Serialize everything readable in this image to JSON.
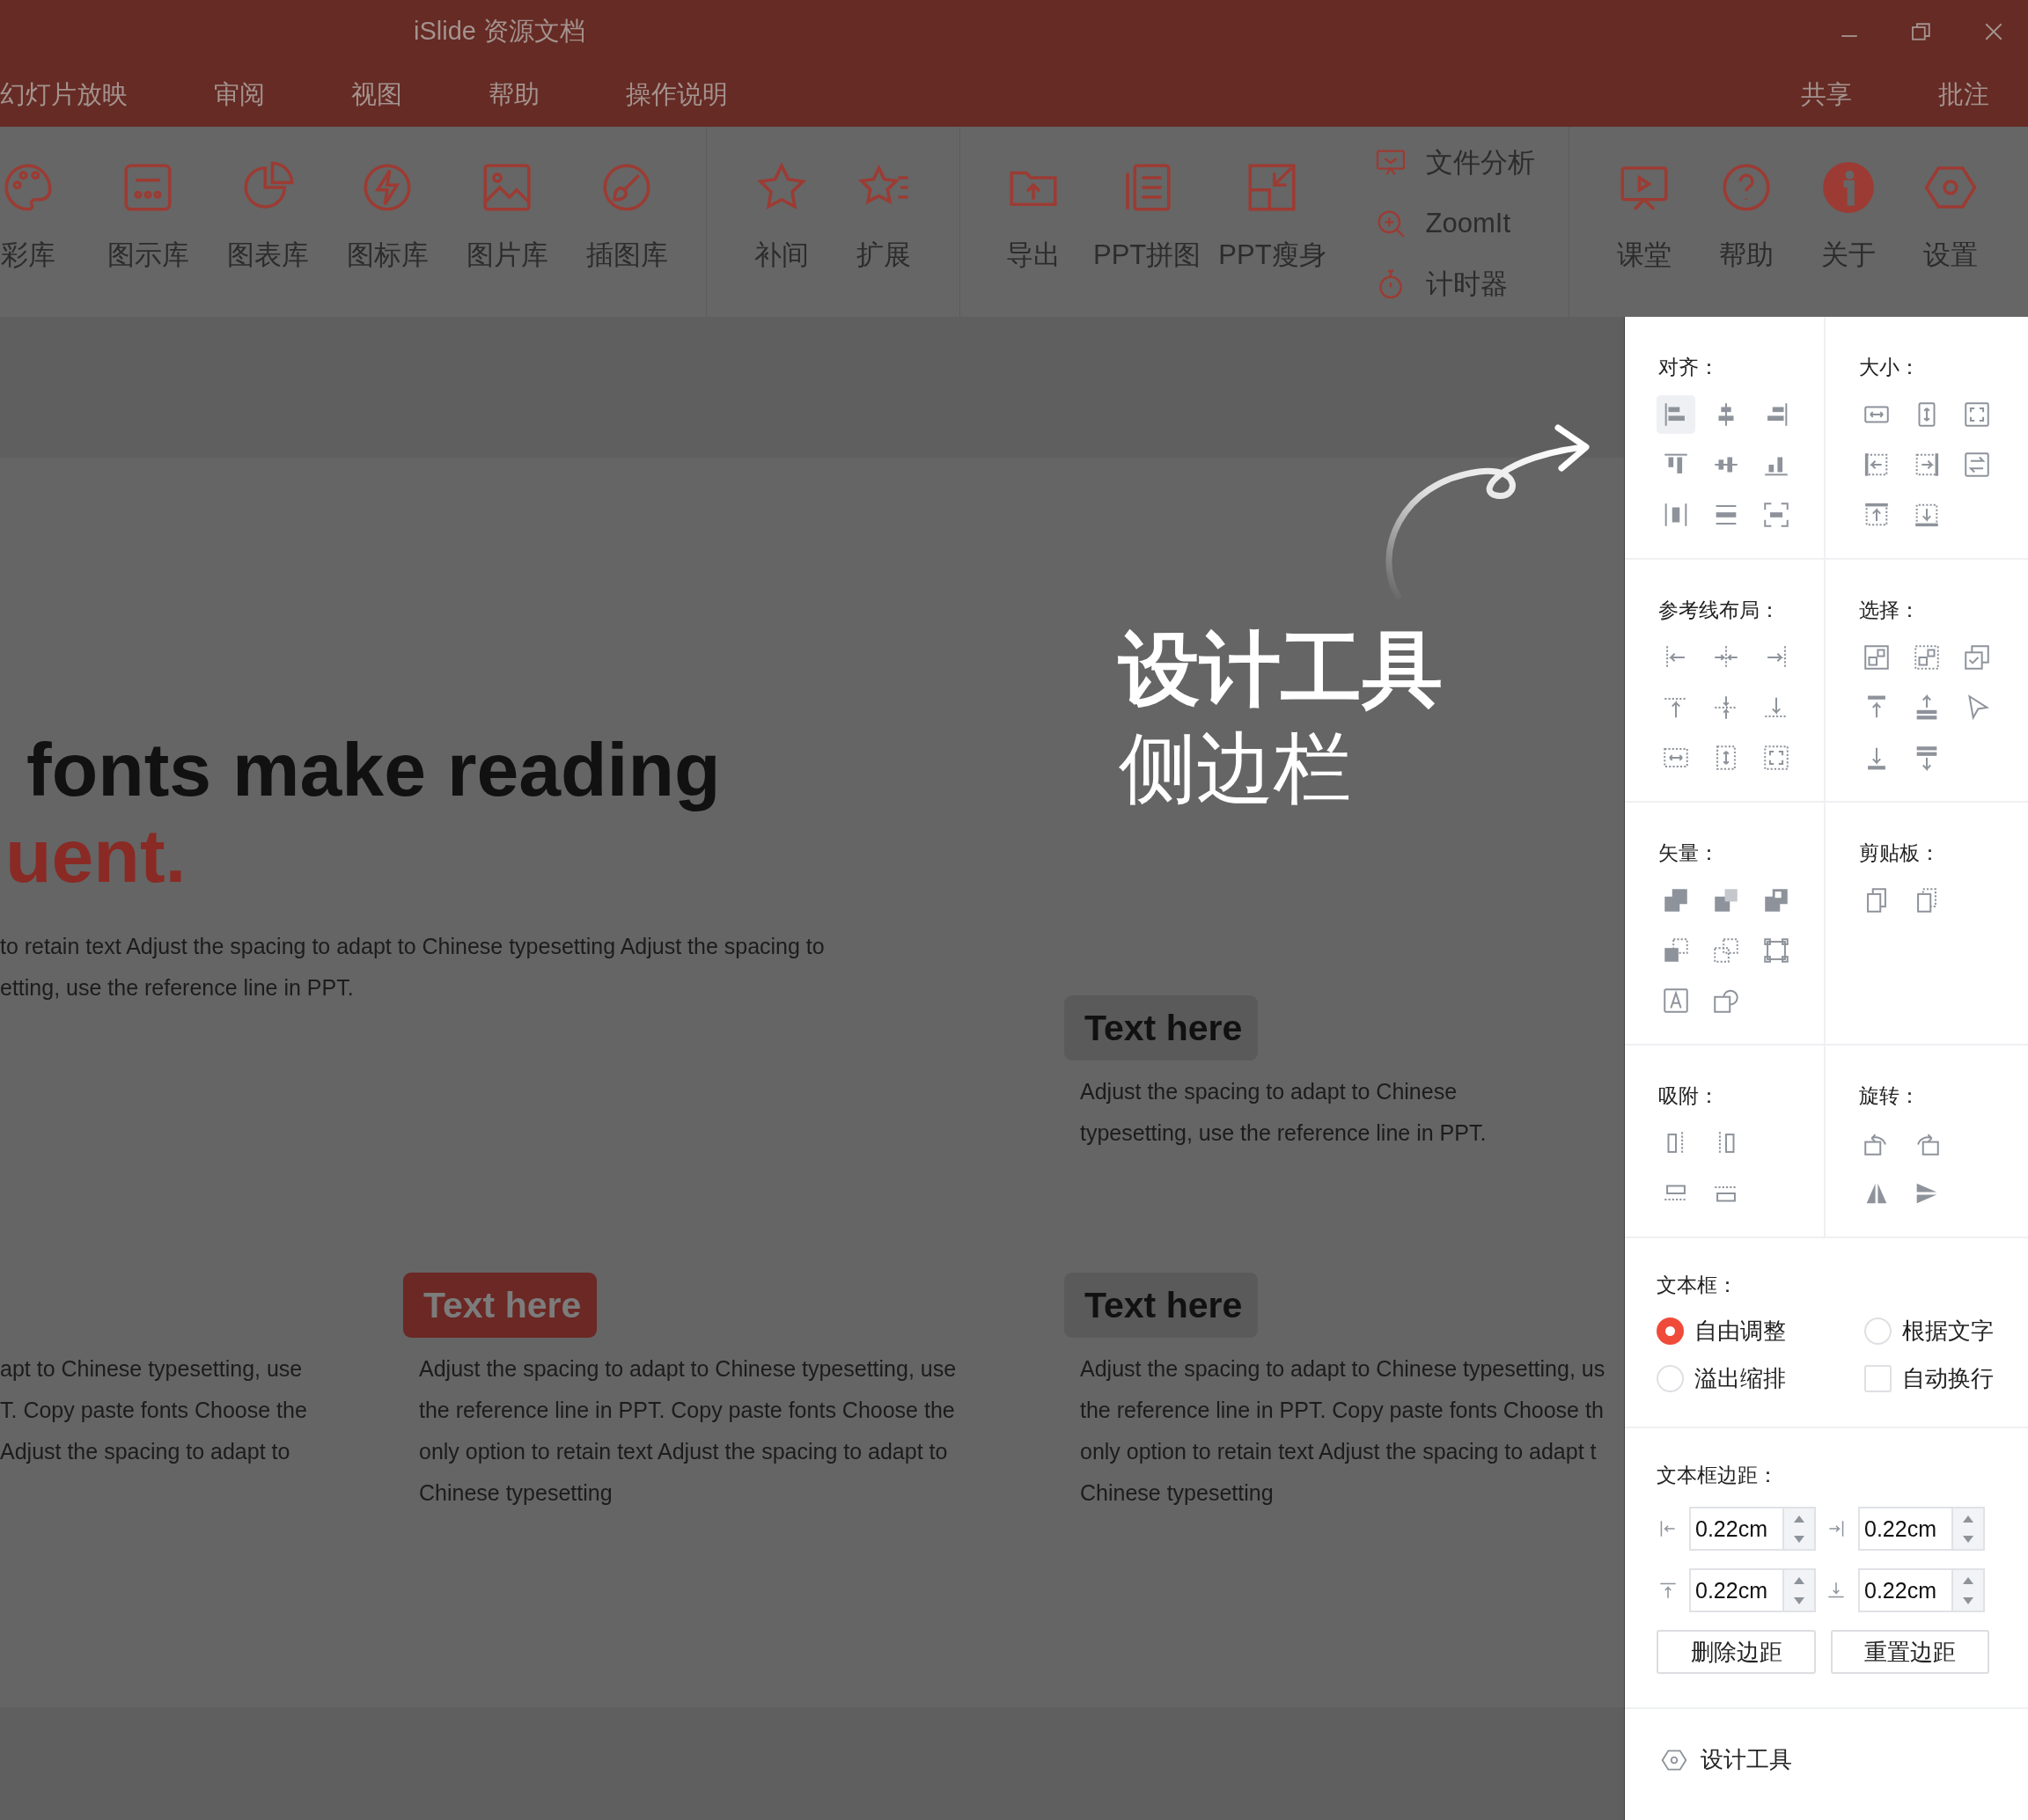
{
  "window": {
    "title": "iSlide 资源文档"
  },
  "menu": {
    "left": [
      {
        "label": "幻灯片放映"
      },
      {
        "label": "审阅"
      },
      {
        "label": "视图"
      },
      {
        "label": "帮助"
      },
      {
        "label": "操作说明"
      }
    ],
    "right": [
      {
        "label": "共享"
      },
      {
        "label": "批注"
      }
    ]
  },
  "toolbar": {
    "groups": [
      {
        "items": [
          {
            "label": "彩库"
          },
          {
            "label": "图示库"
          },
          {
            "label": "图表库"
          },
          {
            "label": "图标库"
          },
          {
            "label": "图片库"
          },
          {
            "label": "插图库"
          }
        ]
      },
      {
        "items": [
          {
            "label": "补间"
          },
          {
            "label": "扩展"
          }
        ]
      },
      {
        "items": [
          {
            "label": "导出"
          },
          {
            "label": "PPT拼图"
          },
          {
            "label": "PPT瘦身"
          }
        ],
        "links": [
          {
            "label": "文件分析"
          },
          {
            "label": "ZoomIt"
          },
          {
            "label": "计时器"
          }
        ]
      },
      {
        "items": [
          {
            "label": "课堂"
          },
          {
            "label": "帮助"
          },
          {
            "label": "关于"
          },
          {
            "label": "设置"
          }
        ]
      }
    ]
  },
  "slide": {
    "heading": [
      {
        "text": "fonts make reading",
        "accent": false
      },
      {
        "text": "uent.",
        "accent": true
      }
    ],
    "intro": [
      "to retain text Adjust the spacing to adapt to Chinese typesetting Adjust the spacing to",
      "etting, use the reference line in PPT."
    ],
    "annotation": {
      "title": "设计工具",
      "subtitle": "侧边栏"
    },
    "top_block": {
      "tag": {
        "label": "Text here",
        "kind": "plain"
      },
      "lines": [
        "Adjust the spacing to adapt to Chinese",
        "typesetting, use the reference line in PPT."
      ]
    },
    "columns": [
      {
        "lines": [
          "apt to Chinese typesetting, use",
          "T. Copy paste fonts Choose the",
          "Adjust the spacing to adapt to"
        ]
      },
      {
        "tag": {
          "label": "Text here",
          "kind": "accent"
        },
        "lines": [
          "Adjust the spacing to adapt to Chinese typesetting, use",
          "the reference line in PPT. Copy paste fonts Choose the",
          "only option to retain text Adjust the spacing to adapt to",
          "Chinese typesetting"
        ]
      },
      {
        "tag": {
          "label": "Text here",
          "kind": "plain"
        },
        "lines": [
          "Adjust the spacing to adapt to Chinese typesetting, us",
          "the reference line in PPT. Copy paste fonts Choose th",
          "only option to retain text Adjust the spacing to adapt t",
          "Chinese typesetting"
        ]
      }
    ]
  },
  "panel": {
    "tool_rows": [
      {
        "sections": [
          {
            "title": "对齐：",
            "tools": [
              {
                "selected": true
              },
              {
                "selected": false
              },
              {
                "selected": false
              },
              {
                "selected": false
              },
              {
                "selected": false
              },
              {
                "selected": false
              },
              {
                "selected": false
              },
              {
                "selected": false
              },
              {
                "selected": false
              }
            ]
          },
          {
            "title": "大小：",
            "tools": [
              {
                "selected": false
              },
              {
                "selected": false
              },
              {
                "selected": false
              },
              {
                "selected": false
              },
              {
                "selected": false
              },
              {
                "selected": false
              },
              {
                "selected": false
              },
              {
                "selected": false
              }
            ]
          }
        ]
      },
      {
        "sections": [
          {
            "title": "参考线布局：",
            "tools": [
              {
                "selected": false
              },
              {
                "selected": false
              },
              {
                "selected": false
              },
              {
                "selected": false
              },
              {
                "selected": false
              },
              {
                "selected": false
              },
              {
                "selected": false
              },
              {
                "selected": false
              },
              {
                "selected": false
              }
            ]
          },
          {
            "title": "选择：",
            "tools": [
              {
                "selected": false
              },
              {
                "selected": false
              },
              {
                "selected": false
              },
              {
                "selected": false
              },
              {
                "selected": false
              },
              {
                "selected": false
              },
              {
                "selected": false
              },
              {
                "selected": false
              }
            ]
          }
        ]
      },
      {
        "sections": [
          {
            "title": "矢量：",
            "tools": [
              {
                "selected": false
              },
              {
                "selected": false
              },
              {
                "selected": false
              },
              {
                "selected": false
              },
              {
                "selected": false
              },
              {
                "selected": false
              },
              {
                "selected": false
              },
              {
                "selected": false
              }
            ]
          },
          {
            "title": "剪贴板：",
            "tools": [
              {
                "selected": false
              },
              {
                "selected": false
              }
            ]
          }
        ]
      },
      {
        "sections": [
          {
            "title": "吸附：",
            "tools": [
              {
                "selected": false
              },
              {
                "selected": false
              },
              {
                "selected": false
              },
              {
                "selected": false
              }
            ]
          },
          {
            "title": "旋转：",
            "tools": [
              {
                "selected": false
              },
              {
                "selected": false
              },
              {
                "selected": false
              },
              {
                "selected": false
              }
            ]
          }
        ]
      }
    ],
    "textbox": {
      "title": "文本框：",
      "options": [
        {
          "kind": "radio",
          "label": "自由调整",
          "selected": true
        },
        {
          "kind": "radio",
          "label": "根据文字",
          "selected": false
        },
        {
          "kind": "radio",
          "label": "溢出缩排",
          "selected": false
        },
        {
          "kind": "checkbox",
          "label": "自动换行",
          "checked": false
        }
      ]
    },
    "margins": {
      "title": "文本框边距：",
      "fields": [
        {
          "value": "0.22cm"
        },
        {
          "value": "0.22cm"
        },
        {
          "value": "0.22cm"
        },
        {
          "value": "0.22cm"
        }
      ],
      "buttons": [
        {
          "label": "删除边距"
        },
        {
          "label": "重置边距"
        }
      ]
    },
    "footer": {
      "label": "设计工具"
    }
  }
}
